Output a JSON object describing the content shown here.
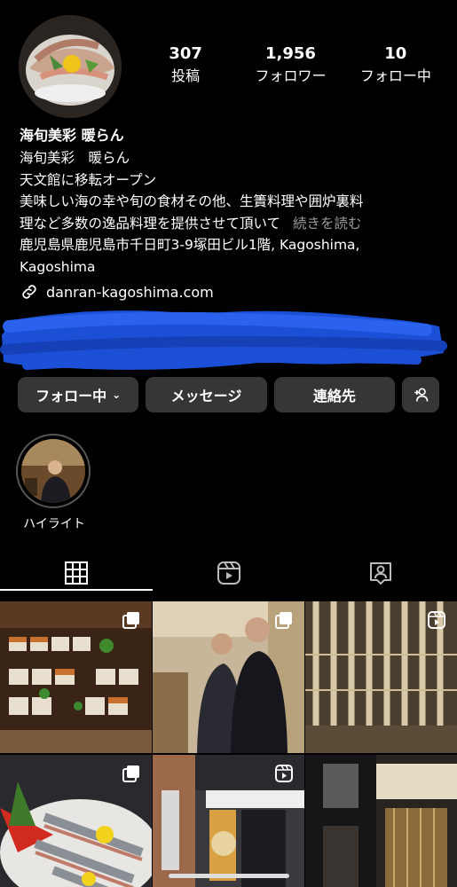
{
  "profile": {
    "stats": [
      {
        "value": "307",
        "label": "投稿"
      },
      {
        "value": "1,956",
        "label": "フォロワー"
      },
      {
        "value": "10",
        "label": "フォロー中"
      }
    ],
    "name": "海旬美彩 暖らん",
    "bio_lines": [
      "海旬美彩　暖らん",
      "天文館に移転オープン",
      "美味しい海の幸や旬の食材その他、生簀料理や囲炉裏料",
      "理など多数の逸品料理を提供させて頂いて"
    ],
    "more_label": "続きを読む",
    "address_lines": [
      "鹿児島県鹿児島市千日町3-9塚田ビル1階, Kagoshima,",
      "Kagoshima"
    ],
    "link": "danran-kagoshima.com"
  },
  "actions": {
    "following_label": "フォロー中",
    "message_label": "メッセージ",
    "contact_label": "連絡先"
  },
  "highlight": {
    "label": "ハイライト"
  },
  "tabs": [
    {
      "name": "posts-grid",
      "active": true
    },
    {
      "name": "reels",
      "active": false
    },
    {
      "name": "tagged",
      "active": false
    }
  ],
  "grid_posts": [
    {
      "subject": "seared sushi platter",
      "badge": "multi"
    },
    {
      "subject": "two men in restaurant entrance",
      "badge": "multi"
    },
    {
      "subject": "wooden lattice wall",
      "badge": "reel"
    },
    {
      "subject": "sashimi boat platter",
      "badge": "multi"
    },
    {
      "subject": "street front with flowers",
      "badge": "reel"
    },
    {
      "subject": "restaurant facade with noren",
      "badge": "none"
    }
  ],
  "colors": {
    "background": "#000000",
    "button": "#363636",
    "muted_text": "#9a9a9a",
    "redaction": "#1a4fd6"
  }
}
